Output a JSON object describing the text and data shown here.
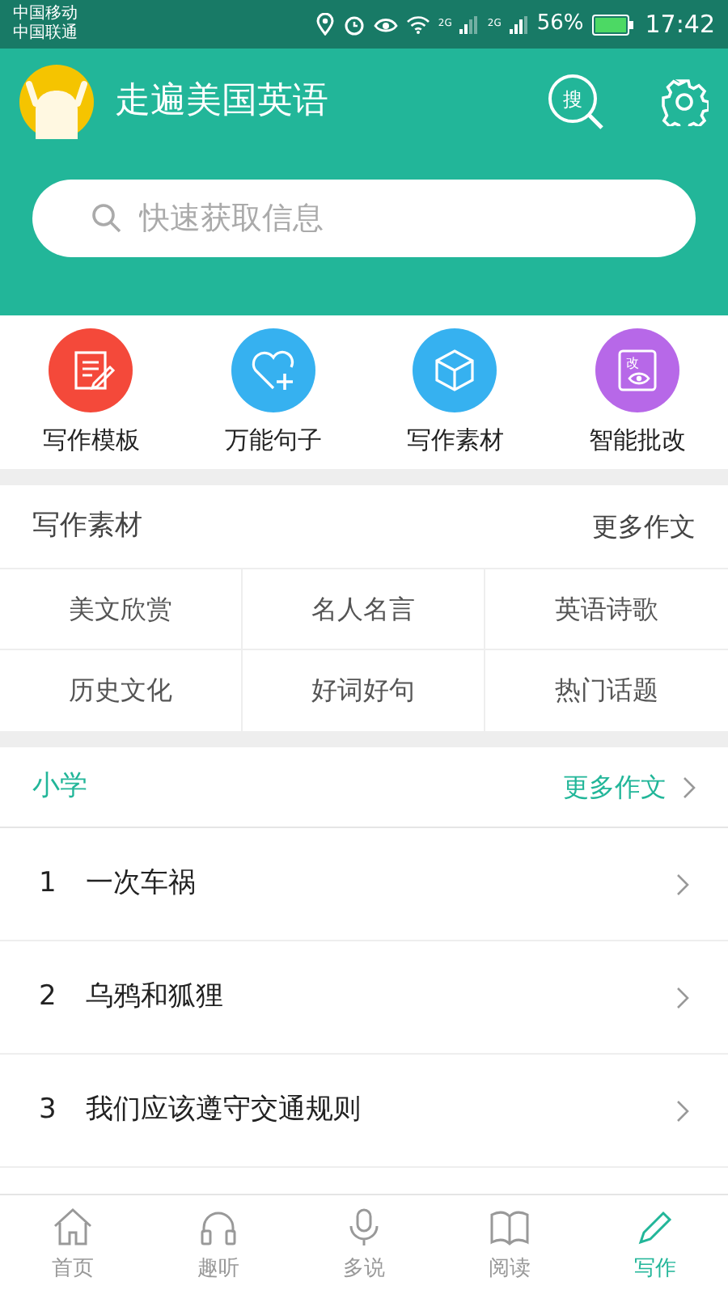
{
  "status_bar": {
    "carriers": [
      "中国移动",
      "中国联通"
    ],
    "network_1": "2G",
    "network_2": "2G",
    "battery": "56%",
    "time": "17:42"
  },
  "header": {
    "title": "走遍美国英语",
    "search_badge": "搜"
  },
  "search": {
    "placeholder": "快速获取信息"
  },
  "shortcuts": [
    {
      "label": "写作模板",
      "kind": "template",
      "color": "#f4493a"
    },
    {
      "label": "万能句子",
      "kind": "heart",
      "color": "#36b1f0"
    },
    {
      "label": "写作素材",
      "kind": "cube",
      "color": "#36b1f0"
    },
    {
      "label": "智能批改",
      "kind": "review",
      "color": "#b768e8",
      "badge": "改"
    }
  ],
  "materials": {
    "title": "写作素材",
    "more": "更多作文",
    "items": [
      "美文欣赏",
      "名人名言",
      "英语诗歌",
      "历史文化",
      "好词好句",
      "热门话题"
    ]
  },
  "primary": {
    "title": "小学",
    "more": "更多作文",
    "rows": [
      {
        "number": "1",
        "title": "一次车祸"
      },
      {
        "number": "2",
        "title": "乌鸦和狐狸"
      },
      {
        "number": "3",
        "title": "我们应该遵守交通规则"
      }
    ]
  },
  "tab_bar": [
    {
      "label": "首页",
      "kind": "home",
      "selected": false
    },
    {
      "label": "趣听",
      "kind": "listen",
      "selected": false
    },
    {
      "label": "多说",
      "kind": "speak",
      "selected": false
    },
    {
      "label": "阅读",
      "kind": "read",
      "selected": false
    },
    {
      "label": "写作",
      "kind": "write",
      "selected": true
    }
  ]
}
